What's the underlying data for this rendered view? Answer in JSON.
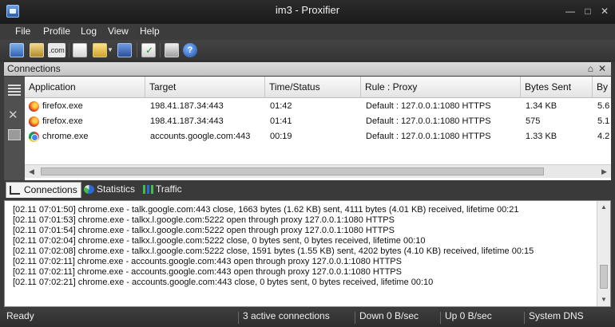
{
  "window": {
    "title": "im3 - Proxifier"
  },
  "menu": [
    "File",
    "Profile",
    "Log",
    "View",
    "Help"
  ],
  "toolbar": {
    "icons": [
      "proxy-servers-icon",
      "rules-icon",
      "name-resolution-icon",
      "new-profile-icon",
      "open-profile-icon",
      "dropdown-icon",
      "save-profile-icon",
      "check-icon",
      "print-icon",
      "help-icon"
    ],
    "label_com": ".com"
  },
  "panel": {
    "title": "Connections"
  },
  "grid": {
    "columns": [
      "Application",
      "Target",
      "Time/Status",
      "Rule : Proxy",
      "Bytes Sent",
      "By"
    ],
    "rows": [
      {
        "icon": "firefox-icon",
        "app": "firefox.exe",
        "target": "198.41.187.34:443",
        "time": "01:42",
        "rule": "Default : 127.0.0.1:1080 HTTPS",
        "sent": "1.34 KB",
        "recv": "5.6"
      },
      {
        "icon": "firefox-icon",
        "app": "firefox.exe",
        "target": "198.41.187.34:443",
        "time": "01:41",
        "rule": "Default : 127.0.0.1:1080 HTTPS",
        "sent": "575",
        "recv": "5.1"
      },
      {
        "icon": "chrome-icon",
        "app": "chrome.exe",
        "target": "accounts.google.com:443",
        "time": "00:19",
        "rule": "Default : 127.0.0.1:1080 HTTPS",
        "sent": "1.33 KB",
        "recv": "4.2"
      }
    ]
  },
  "tabs": [
    "Connections",
    "Statistics",
    "Traffic"
  ],
  "log": [
    "[02.11 07:01:50] chrome.exe - talk.google.com:443 close, 1663 bytes (1.62 KB) sent, 4111 bytes (4.01 KB) received, lifetime 00:21",
    "[02.11 07:01:53] chrome.exe - talkx.l.google.com:5222 open through proxy 127.0.0.1:1080 HTTPS",
    "[02.11 07:01:54] chrome.exe - talkx.l.google.com:5222 open through proxy 127.0.0.1:1080 HTTPS",
    "[02.11 07:02:04] chrome.exe - talkx.l.google.com:5222 close, 0 bytes sent, 0 bytes received, lifetime 00:10",
    "[02.11 07:02:08] chrome.exe - talkx.l.google.com:5222 close, 1591 bytes (1.55 KB) sent, 4202 bytes (4.10 KB) received, lifetime 00:15",
    "[02.11 07:02:11] chrome.exe - accounts.google.com:443 open through proxy 127.0.0.1:1080 HTTPS",
    "[02.11 07:02:11] chrome.exe - accounts.google.com:443 open through proxy 127.0.0.1:1080 HTTPS",
    "[02.11 07:02:21] chrome.exe - accounts.google.com:443 close, 0 bytes sent, 0 bytes received, lifetime 00:10"
  ],
  "status": {
    "ready": "Ready",
    "connections": "3 active connections",
    "down": "Down 0 B/sec",
    "up": "Up 0 B/sec",
    "dns": "System DNS"
  }
}
